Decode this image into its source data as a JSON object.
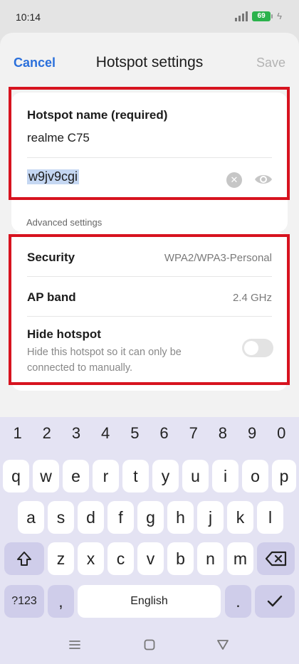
{
  "status_bar": {
    "time": "10:14",
    "battery": "69"
  },
  "header": {
    "cancel": "Cancel",
    "title": "Hotspot settings",
    "save": "Save"
  },
  "hotspot": {
    "name_label": "Hotspot name (required)",
    "name_value": "realme C75",
    "password_value": "w9jv9cgi"
  },
  "advanced": {
    "section_label": "Advanced settings",
    "security_label": "Security",
    "security_value": "WPA2/WPA3-Personal",
    "band_label": "AP band",
    "band_value": "2.4 GHz",
    "hide_label": "Hide hotspot",
    "hide_description": "Hide this hotspot so it can only be connected to manually.",
    "hide_enabled": false
  },
  "keyboard": {
    "numbers": [
      "1",
      "2",
      "3",
      "4",
      "5",
      "6",
      "7",
      "8",
      "9",
      "0"
    ],
    "row1": [
      "q",
      "w",
      "e",
      "r",
      "t",
      "y",
      "u",
      "i",
      "o",
      "p"
    ],
    "row2": [
      "a",
      "s",
      "d",
      "f",
      "g",
      "h",
      "j",
      "k",
      "l"
    ],
    "row3": [
      "z",
      "x",
      "c",
      "v",
      "b",
      "n",
      "m"
    ],
    "symbols_key": "?123",
    "comma_key": ",",
    "space_label": "English",
    "period_key": "."
  },
  "colors": {
    "accent": "#2a6fdb",
    "highlight_box": "#d7131f",
    "battery": "#2bb24c"
  }
}
